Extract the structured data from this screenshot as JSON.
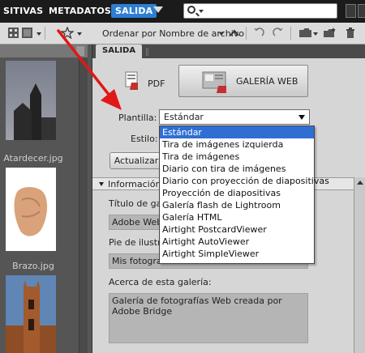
{
  "topbar": {
    "tabs": [
      "SITIVAS",
      "METADATOS",
      "SALIDA"
    ],
    "active_tab": "SALIDA"
  },
  "toolbar": {
    "sort_label": "Ordenar por Nombre de archivo"
  },
  "thumbnails": [
    {
      "caption": "Atardecer.jpg"
    },
    {
      "caption": "Brazo.jpg"
    },
    {
      "caption": ""
    }
  ],
  "panel": {
    "tab": "SALIDA",
    "pdf_label": "PDF",
    "web_label": "GALERÍA WEB",
    "plantilla_label": "Plantilla:",
    "plantilla_value": "Estándar",
    "estilo_label": "Estilo:",
    "actualizar_label": "Actualizar",
    "section_title": "Información d",
    "titulo_label": "Título de galer",
    "titulo_value": "Adobe Web G",
    "pie_label": "Pie de ilustrac",
    "pie_value": "Mis fotografías",
    "acerca_label": "Acerca de esta galería:",
    "acerca_value": "Galería de fotografías Web creada por Adobe Bridge"
  },
  "dropdown_options": [
    "Estándar",
    "Tira de imágenes izquierda",
    "Tira de imágenes",
    "Diario con tira de imágenes",
    "Diario con proyección de diapositivas",
    "Proyección de diapositivas",
    "Galería flash de Lightroom",
    "Galería HTML",
    "Airtight PostcardViewer",
    "Airtight AutoViewer",
    "Airtight SimpleViewer"
  ],
  "selected_option": "Estándar",
  "colors": {
    "accent": "#2e7fd3",
    "selection": "#2f6fd3",
    "annotation_arrow": "#e01818"
  }
}
